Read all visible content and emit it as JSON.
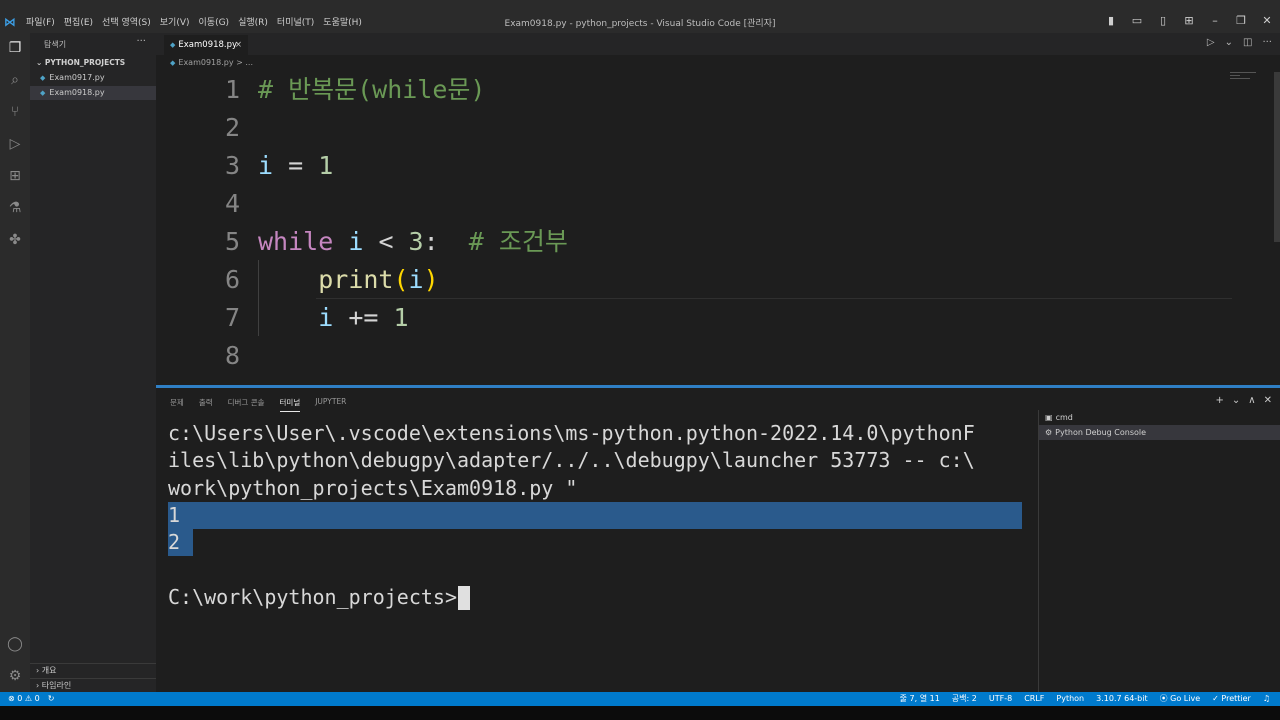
{
  "titlebar": {
    "menu": [
      "파일(F)",
      "편집(E)",
      "선택 영역(S)",
      "보기(V)",
      "이동(G)",
      "실행(R)",
      "터미널(T)",
      "도움말(H)"
    ],
    "title": "Exam0918.py - python_projects - Visual Studio Code [관리자]"
  },
  "sidebar": {
    "header": "탐색기",
    "more": "···",
    "section": "PYTHON_PROJECTS",
    "files": [
      {
        "name": "Exam0917.py"
      },
      {
        "name": "Exam0918.py"
      }
    ],
    "outline": "개요",
    "timeline": "타임라인"
  },
  "editor": {
    "tab_label": "Exam0918.py",
    "tab_close": "×",
    "breadcrumb": "Exam0918.py > ...",
    "lines": [
      {
        "num": "1",
        "tokens": [
          {
            "t": "# 반복문(while문)",
            "c": "comment"
          }
        ]
      },
      {
        "num": "2",
        "tokens": []
      },
      {
        "num": "3",
        "tokens": [
          {
            "t": "i",
            "c": "var"
          },
          {
            "t": " = ",
            "c": "op"
          },
          {
            "t": "1",
            "c": "num"
          }
        ]
      },
      {
        "num": "4",
        "tokens": []
      },
      {
        "num": "5",
        "tokens": [
          {
            "t": "while",
            "c": "kw"
          },
          {
            "t": " ",
            "c": "op"
          },
          {
            "t": "i",
            "c": "var"
          },
          {
            "t": " < ",
            "c": "op"
          },
          {
            "t": "3",
            "c": "num"
          },
          {
            "t": ":  ",
            "c": "op"
          },
          {
            "t": "# 조건부",
            "c": "comment"
          }
        ]
      },
      {
        "num": "6",
        "tokens": [
          {
            "t": "    ",
            "c": "op"
          },
          {
            "t": "print",
            "c": "fn"
          },
          {
            "t": "(",
            "c": "paren"
          },
          {
            "t": "i",
            "c": "var"
          },
          {
            "t": ")",
            "c": "paren"
          }
        ]
      },
      {
        "num": "7",
        "tokens": [
          {
            "t": "    ",
            "c": "op"
          },
          {
            "t": "i",
            "c": "var"
          },
          {
            "t": " += ",
            "c": "op"
          },
          {
            "t": "1",
            "c": "num"
          }
        ]
      },
      {
        "num": "8",
        "tokens": []
      }
    ]
  },
  "panel": {
    "tabs": [
      "문제",
      "출력",
      "디버그 콘솔",
      "터미널",
      "JUPYTER"
    ],
    "active_tab": "터미널",
    "terminal_lines": [
      "c:\\Users\\User\\.vscode\\extensions\\ms-python.python-2022.14.0\\pythonF",
      "iles\\lib\\python\\debugpy\\adapter/../..\\debugpy\\launcher 53773 -- c:\\",
      "work\\python_projects\\Exam0918.py \"",
      "1",
      "2",
      "",
      "C:\\work\\python_projects>"
    ],
    "terminals": [
      {
        "name": "cmd"
      },
      {
        "name": "Python Debug Console"
      }
    ]
  },
  "statusbar": {
    "errors": "⊗ 0 ⚠ 0",
    "position": "줄 7, 열 11",
    "spaces": "공백: 2",
    "encoding": "UTF-8",
    "eol": "CRLF",
    "language": "Python",
    "interpreter": "3.10.7 64-bit",
    "golive": "Go Live",
    "prettier": "✓ Prettier"
  },
  "colors": {
    "statusbar": "#007acc",
    "comment": "#6a9955",
    "keyword": "#c586c0",
    "variable": "#9cdcfe",
    "number": "#b5cea8",
    "function": "#dcdcaa",
    "selection": "#2a5a8c"
  },
  "icons": [
    "explorer-icon",
    "search-icon",
    "source-control-icon",
    "run-debug-icon",
    "extensions-icon",
    "testing-icon",
    "python-icon",
    "account-icon",
    "settings-gear-icon"
  ]
}
